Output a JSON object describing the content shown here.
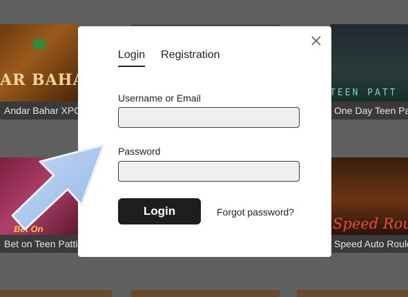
{
  "background_tiles": [
    {
      "caption": "Andar Bahar XPG",
      "thumb_text": "AR BAHAR"
    },
    {
      "caption": "One Day Teen Patti",
      "thumb_text": "TEEN PATT"
    },
    {
      "caption": "Bet on Teen Patti",
      "thumb_text": "Bet On"
    },
    {
      "caption": "Speed Auto Roulette",
      "thumb_text": "Speed Roul"
    }
  ],
  "modal": {
    "tabs": [
      {
        "label": "Login",
        "active": true
      },
      {
        "label": "Registration",
        "active": false
      }
    ],
    "username_label": "Username or Email",
    "username_value": "",
    "password_label": "Password",
    "password_value": "",
    "login_button": "Login",
    "forgot_link": "Forgot password?"
  },
  "icons": {
    "close": "close-icon",
    "pointer": "pointer-arrow-icon"
  },
  "colors": {
    "overlay": "#5f5f5f",
    "modal_bg": "#ffffff",
    "button_bg": "#1e1e1e",
    "input_bg": "#eef0f0",
    "arrow": "#a9c6ee"
  }
}
